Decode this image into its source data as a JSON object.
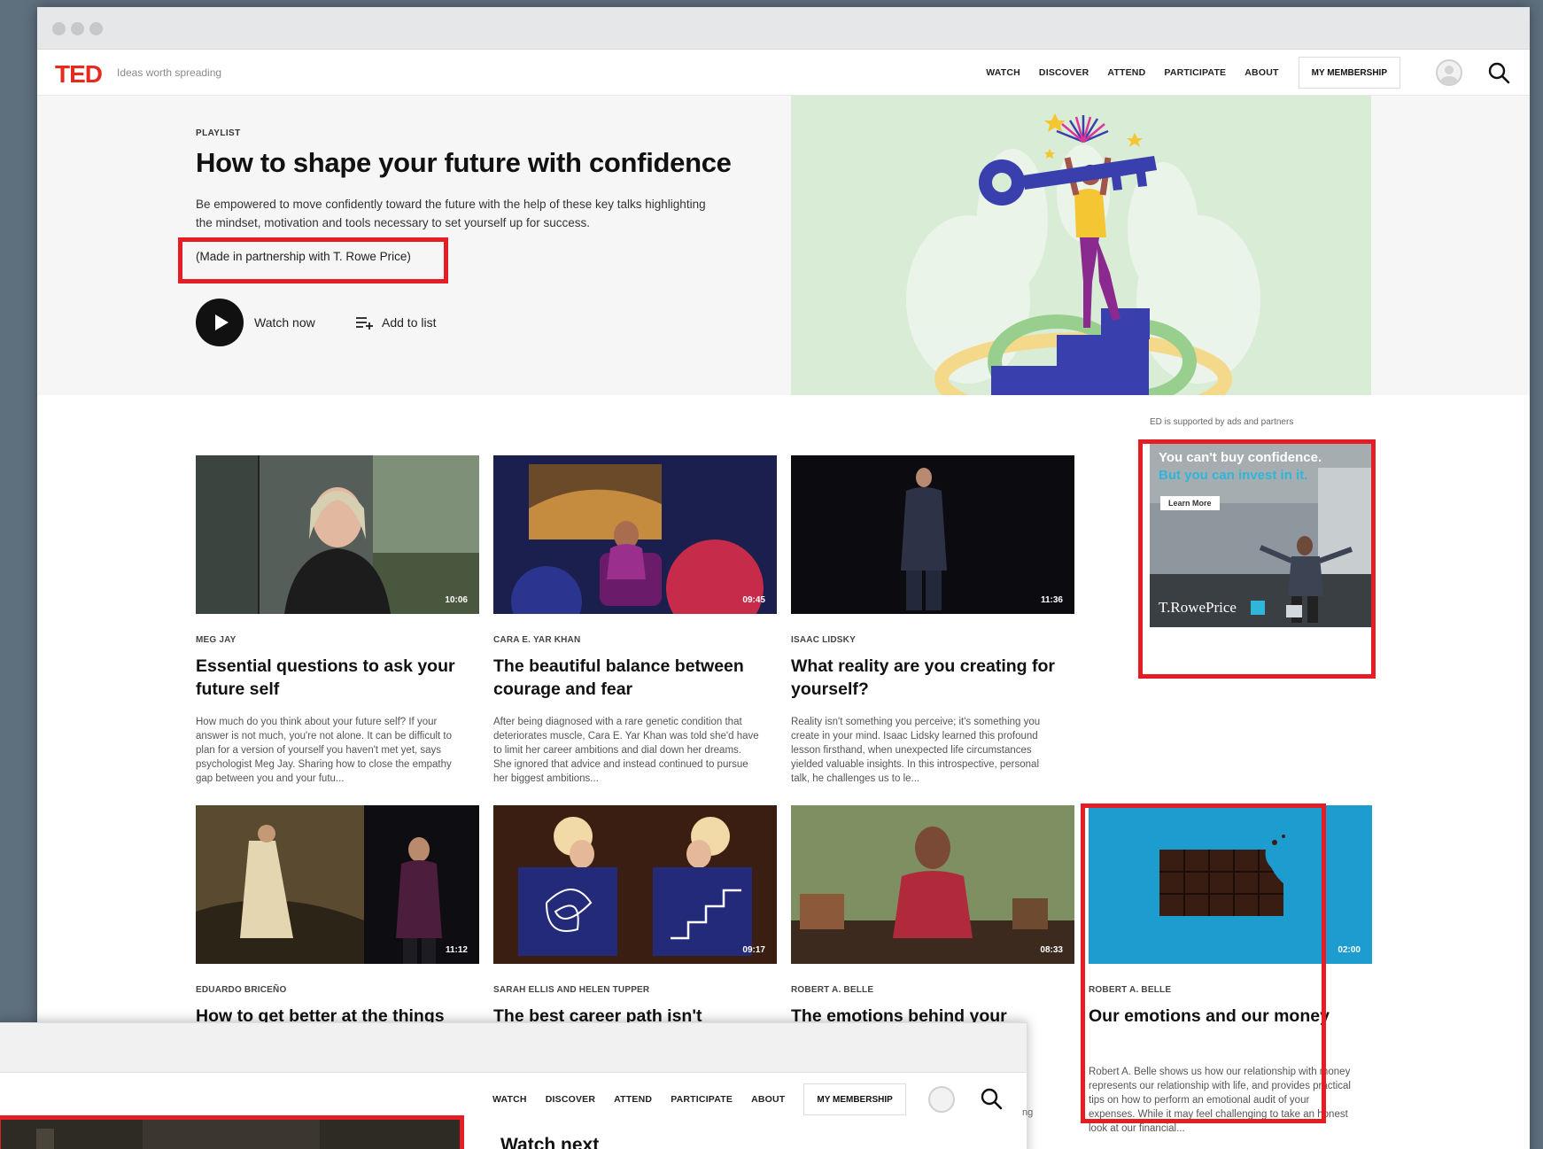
{
  "browser": {
    "window_dots": 3
  },
  "nav": {
    "logo": "TED",
    "tagline": "Ideas worth spreading",
    "links": [
      "WATCH",
      "DISCOVER",
      "ATTEND",
      "PARTICIPATE",
      "ABOUT"
    ],
    "membership": "MY MEMBERSHIP"
  },
  "hero": {
    "eyebrow": "PLAYLIST",
    "title": "How to shape your future with confidence",
    "description": "Be empowered to move confidently toward the future with the help of these key talks highlighting the mindset, motivation and tools necessary to set yourself up for success.",
    "partnership": "(Made in partnership with T. Rowe Price)",
    "watch_now": "Watch now",
    "add_to_list": "Add to list"
  },
  "talks": [
    {
      "speaker": "MEG JAY",
      "title": "Essential questions to ask your future self",
      "duration": "10:06",
      "description": "How much do you think about your future self? If your answer is not much, you're not alone. It can be difficult to plan for a version of yourself you haven't met yet, says psychologist Meg Jay. Sharing how to close the empathy gap between you and your futu..."
    },
    {
      "speaker": "CARA E. YAR KHAN",
      "title": "The beautiful balance between courage and fear",
      "duration": "09:45",
      "description": "After being diagnosed with a rare genetic condition that deteriorates muscle, Cara E. Yar Khan was told she'd have to limit her career ambitions and dial down her dreams. She ignored that advice and instead continued to pursue her biggest ambitions..."
    },
    {
      "speaker": "ISAAC LIDSKY",
      "title": "What reality are you creating for yourself?",
      "duration": "11:36",
      "description": "Reality isn't something you perceive; it's something you create in your mind. Isaac Lidsky learned this profound lesson firsthand, when unexpected life circumstances yielded valuable insights. In this introspective, personal talk, he challenges us to le..."
    },
    {
      "speaker": "EDUARDO BRICEÑO",
      "title": "How to get better at the things",
      "duration": "11:12",
      "description": ""
    },
    {
      "speaker": "SARAH ELLIS AND HELEN TUPPER",
      "title": "The best career path isn't",
      "duration": "09:17",
      "description": ""
    },
    {
      "speaker": "ROBERT A. BELLE",
      "title": "The emotions behind your",
      "duration": "08:33",
      "description": ""
    },
    {
      "speaker": "ROBERT A. BELLE",
      "title": "Our emotions and our money",
      "duration": "02:00",
      "description": "Robert A. Belle shows us how our relationship with money represents our relationship with life, and provides practical tips on how to perform an emotional audit of your expenses. While it may feel challenging to take an honest look at our financial..."
    }
  ],
  "ad": {
    "label": "ED is supported by ads and partners",
    "headline": "You can't buy confidence.",
    "subline": "But you can invest in it.",
    "button": "Learn More",
    "brand": "T.RowePrice"
  },
  "overlay": {
    "links": [
      "WATCH",
      "DISCOVER",
      "ATTEND",
      "PARTICIPATE",
      "ABOUT"
    ],
    "membership": "MY MEMBERSHIP",
    "watch_next": "Watch next",
    "partial_text": "ng"
  },
  "colors": {
    "ted_red": "#e62b1e",
    "highlight_red": "#e51d24",
    "background": "#5e6f7e"
  }
}
